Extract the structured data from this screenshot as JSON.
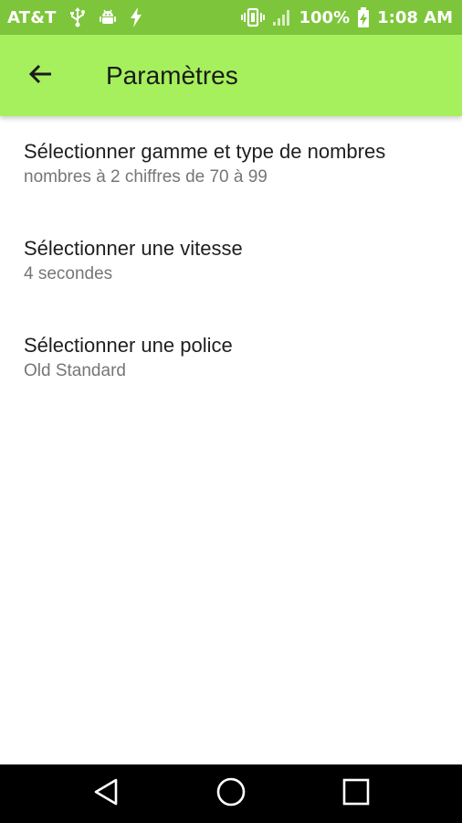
{
  "status_bar": {
    "carrier": "AT&T",
    "battery_percent": "100%",
    "time": "1:08 AM",
    "left_icons": [
      "usb-icon",
      "android-debug-icon",
      "charging-bolt-icon"
    ],
    "right_icons": [
      "vibrate-icon",
      "signal-icon",
      "battery-charging-icon"
    ]
  },
  "app_bar": {
    "title": "Paramètres",
    "back_icon": "arrow-back-icon"
  },
  "settings": [
    {
      "title": "Sélectionner gamme et type de nombres",
      "summary": "nombres à 2 chiffres de 70 à 99"
    },
    {
      "title": "Sélectionner une vitesse",
      "summary": "4 secondes"
    },
    {
      "title": "Sélectionner une police",
      "summary": "Old Standard"
    }
  ],
  "nav_bar": {
    "buttons": [
      "back-triangle-icon",
      "home-circle-icon",
      "recents-square-icon"
    ]
  },
  "colors": {
    "status_bar": "#7dc53a",
    "app_bar": "#a5f05c",
    "title_text": "#1f1f1f",
    "summary_text": "#767676",
    "nav_bar": "#000000"
  }
}
